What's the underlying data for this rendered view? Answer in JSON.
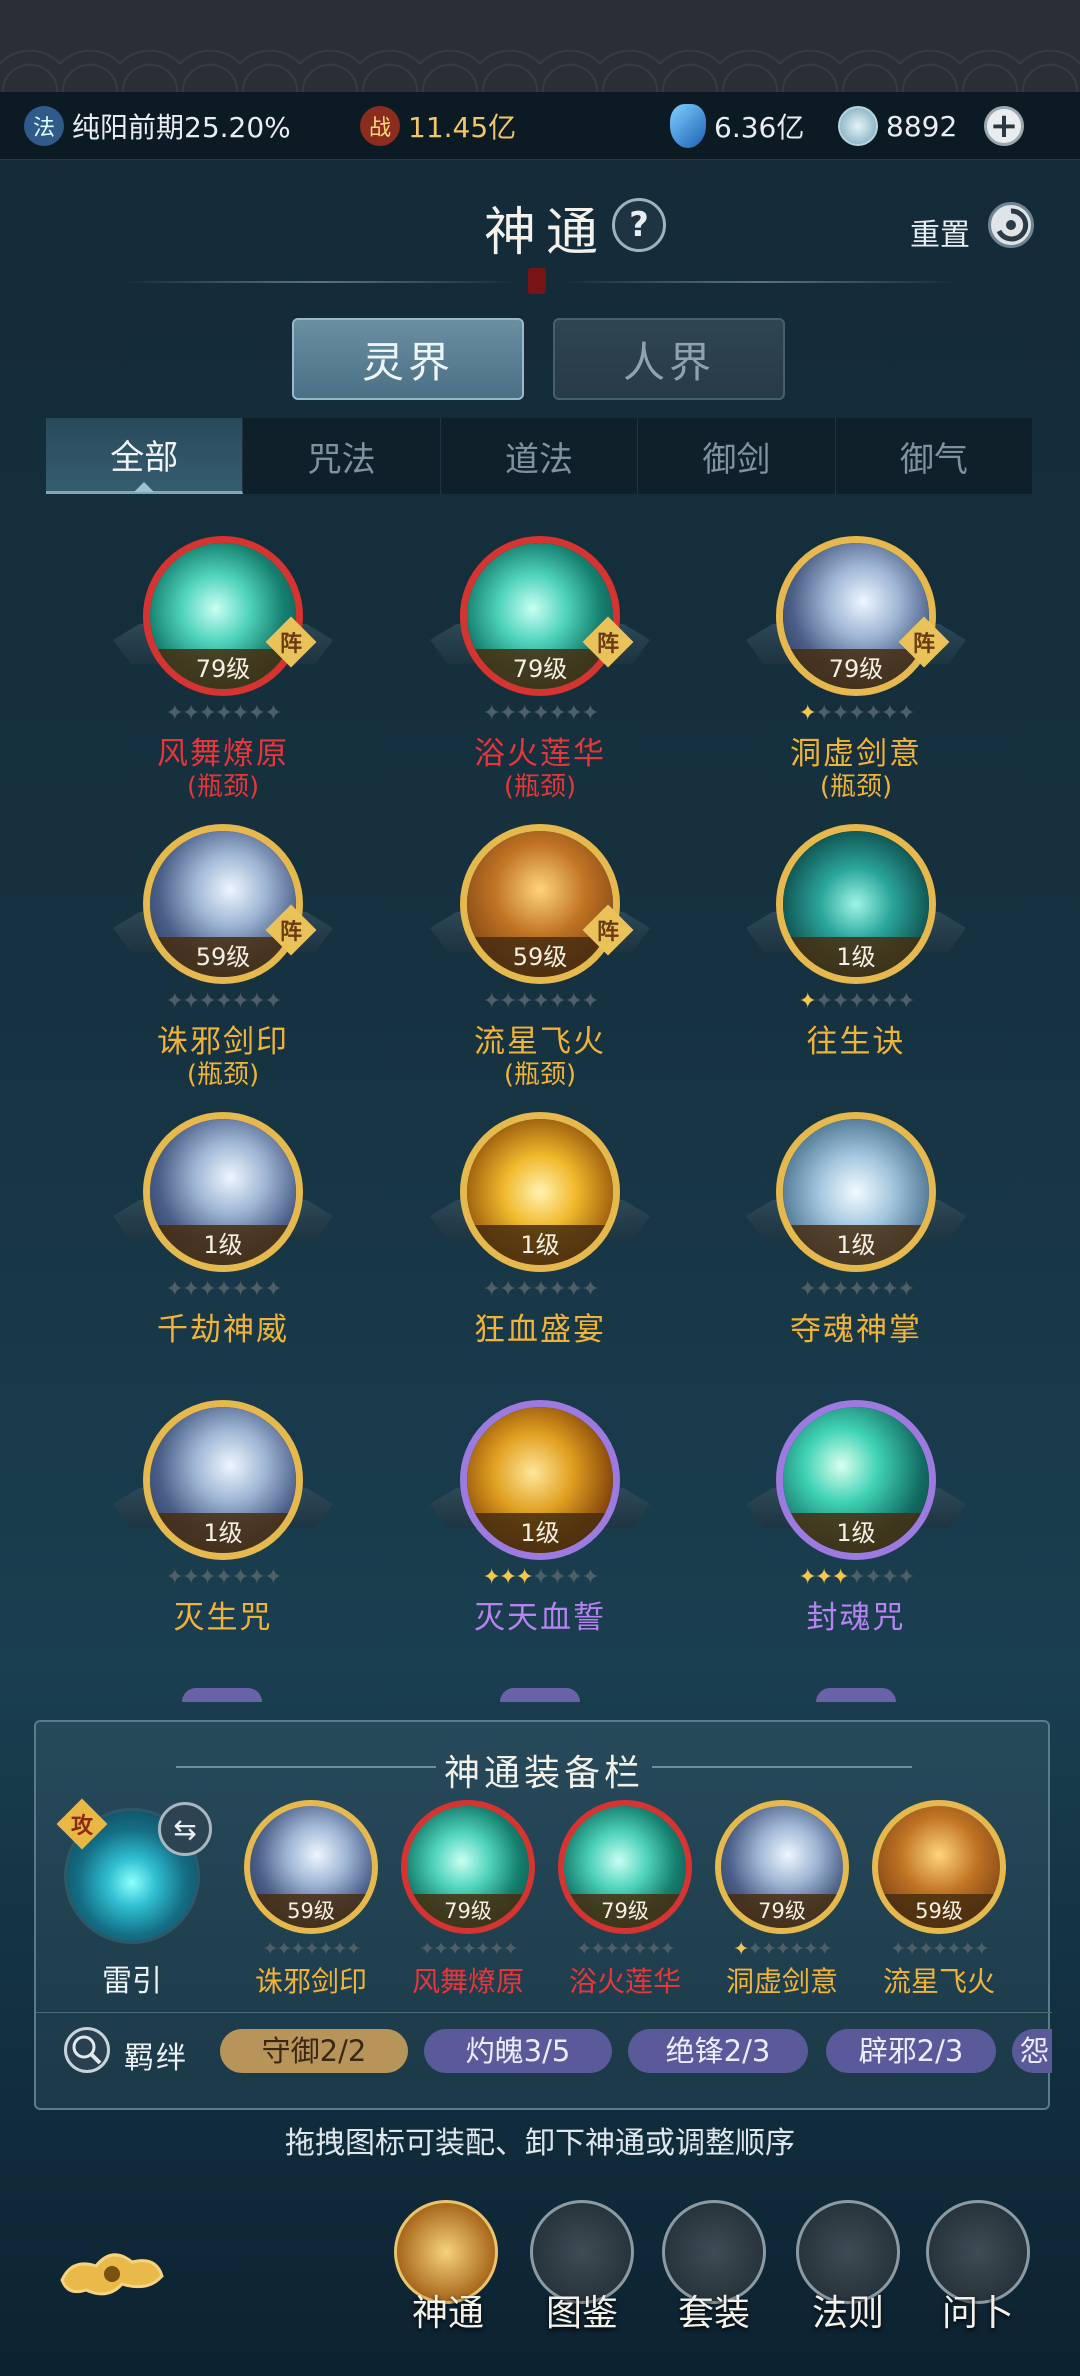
{
  "topbar": {
    "realm": {
      "icon": "fa-badge-icon",
      "icon_char": "法",
      "text": "纯阳前期25.20%"
    },
    "power": {
      "icon": "battle-badge-icon",
      "icon_char": "战",
      "text": "11.45亿"
    },
    "spirit_stone": {
      "icon": "blue-crystal-icon",
      "text": "6.36亿"
    },
    "jade": {
      "icon": "silver-coin-icon",
      "text": "8892"
    },
    "add": "+"
  },
  "header": {
    "title": "神通",
    "help": "?",
    "reset": "重置"
  },
  "realm_tabs": [
    "灵界",
    "人界"
  ],
  "categories": [
    "全部",
    "咒法",
    "道法",
    "御剑",
    "御气"
  ],
  "skills": [
    {
      "name": "风舞燎原",
      "level": "79级",
      "tag": "阵",
      "sub": "(瓶颈)",
      "frame": "red",
      "name_color": "#e5363a",
      "stars": 0
    },
    {
      "name": "浴火莲华",
      "level": "79级",
      "tag": "阵",
      "sub": "(瓶颈)",
      "frame": "red",
      "name_color": "#e5363a",
      "stars": 0
    },
    {
      "name": "洞虚剑意",
      "level": "79级",
      "tag": "阵",
      "sub": "(瓶颈)",
      "frame": "gold",
      "name_color": "#efb33a",
      "stars": 1
    },
    {
      "name": "诛邪剑印",
      "level": "59级",
      "tag": "阵",
      "sub": "(瓶颈)",
      "frame": "gold",
      "name_color": "#efb33a",
      "stars": 0
    },
    {
      "name": "流星飞火",
      "level": "59级",
      "tag": "阵",
      "sub": "(瓶颈)",
      "frame": "gold",
      "name_color": "#efb33a",
      "stars": 0
    },
    {
      "name": "往生诀",
      "level": "1级",
      "tag": "",
      "sub": "",
      "frame": "gold",
      "name_color": "#efb33a",
      "stars": 1
    },
    {
      "name": "千劫神威",
      "level": "1级",
      "tag": "",
      "sub": "",
      "frame": "gold",
      "name_color": "#efb33a",
      "stars": 0
    },
    {
      "name": "狂血盛宴",
      "level": "1级",
      "tag": "",
      "sub": "",
      "frame": "gold",
      "name_color": "#efb33a",
      "stars": 0
    },
    {
      "name": "夺魂神掌",
      "level": "1级",
      "tag": "",
      "sub": "",
      "frame": "gold",
      "name_color": "#efb33a",
      "stars": 0
    },
    {
      "name": "灭生咒",
      "level": "1级",
      "tag": "",
      "sub": "",
      "frame": "gold",
      "name_color": "#efb33a",
      "stars": 0
    },
    {
      "name": "灭天血誓",
      "level": "1级",
      "tag": "",
      "sub": "",
      "frame": "purple",
      "name_color": "#b783f0",
      "stars": 3
    },
    {
      "name": "封魂咒",
      "level": "1级",
      "tag": "",
      "sub": "",
      "frame": "purple",
      "name_color": "#b783f0",
      "stars": 3
    }
  ],
  "equip": {
    "title": "神通装备栏",
    "main_skill": {
      "name": "雷引",
      "tag": "攻"
    },
    "slots": [
      {
        "name": "诛邪剑印",
        "level": "59级",
        "frame": "gold",
        "name_color": "#efb33a",
        "stars": 0
      },
      {
        "name": "风舞燎原",
        "level": "79级",
        "frame": "red",
        "name_color": "#e5363a",
        "stars": 0
      },
      {
        "name": "浴火莲华",
        "level": "79级",
        "frame": "red",
        "name_color": "#e5363a",
        "stars": 0
      },
      {
        "name": "洞虚剑意",
        "level": "79级",
        "frame": "gold",
        "name_color": "#efb33a",
        "stars": 1
      },
      {
        "name": "流星飞火",
        "level": "59级",
        "frame": "gold",
        "name_color": "#efb33a",
        "stars": 0
      }
    ],
    "bond_label": "羁绊",
    "bonds": [
      {
        "text": "守御2/2",
        "style": "gold"
      },
      {
        "text": "灼魄3/5",
        "style": "purple"
      },
      {
        "text": "绝锋2/3",
        "style": "purple"
      },
      {
        "text": "辟邪2/3",
        "style": "purple"
      },
      {
        "text": "怨",
        "style": "purple"
      }
    ]
  },
  "hint": "拖拽图标可装配、卸下神通或调整顺序",
  "bottom_nav": [
    "神通",
    "图鉴",
    "套装",
    "法则",
    "问卜"
  ]
}
